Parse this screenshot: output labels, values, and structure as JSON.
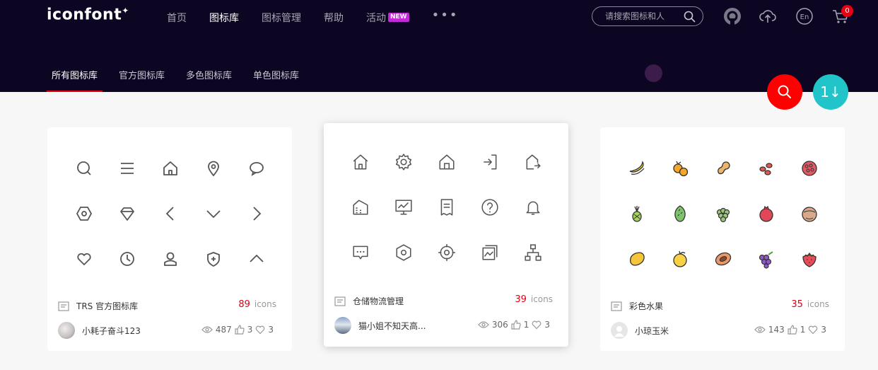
{
  "header": {
    "logo": "iconfont",
    "logo_mark": "✦",
    "nav": [
      {
        "label": "首页",
        "active": false
      },
      {
        "label": "图标库",
        "active": true
      },
      {
        "label": "图标管理",
        "active": false
      },
      {
        "label": "帮助",
        "active": false
      },
      {
        "label": "活动",
        "active": false,
        "badge": "NEW"
      }
    ],
    "more": "•••",
    "search_placeholder": "请搜索图标和人",
    "icons": [
      "user-avatar-icon",
      "upload-icon",
      "language-icon",
      "cart-icon"
    ],
    "language": "En",
    "cart_count": "0"
  },
  "subnav": [
    {
      "label": "所有图标库",
      "active": true
    },
    {
      "label": "官方图标库",
      "active": false
    },
    {
      "label": "多色图标库",
      "active": false
    },
    {
      "label": "单色图标库",
      "active": false
    }
  ],
  "fab": {
    "sort_glyph": "1↓"
  },
  "cards": [
    {
      "title": "TRS 官方图标库",
      "count": "89",
      "unit": "icons",
      "author": "小耗子奋斗123",
      "views": "487",
      "likes": "3",
      "favorites": "3",
      "icons": [
        "search",
        "menu",
        "home",
        "location",
        "chat",
        "hexagon",
        "diamond",
        "chevron-left",
        "chevron-down",
        "chevron-right",
        "heart",
        "clock",
        "user",
        "shield-plus",
        "chevron-up"
      ]
    },
    {
      "title": "仓储物流管理",
      "count": "39",
      "unit": "icons",
      "author": "猫小姐不知天高...",
      "views": "306",
      "likes": "1",
      "favorites": "3",
      "icons": [
        "home",
        "settings",
        "warehouse",
        "exit",
        "house-arrow",
        "building",
        "monitor-chart",
        "receipt",
        "help",
        "bell",
        "message",
        "hexagon",
        "target",
        "photos",
        "org-chart"
      ]
    },
    {
      "title": "彩色水果",
      "count": "35",
      "unit": "icons",
      "author": "小琼玉米",
      "views": "143",
      "likes": "1",
      "favorites": "3",
      "icons": [
        "banana",
        "loquat",
        "peanut",
        "goji",
        "raspberry",
        "pineapple",
        "durian",
        "grapes-bunch",
        "pomegranate",
        "hazelnut",
        "mango",
        "orange",
        "papaya",
        "grapes",
        "strawberry"
      ]
    }
  ],
  "colors": {
    "header_bg": "#0c0622",
    "accent_red": "#e60012",
    "teal": "#21c5c9",
    "new_badge": "#c22ad8"
  }
}
